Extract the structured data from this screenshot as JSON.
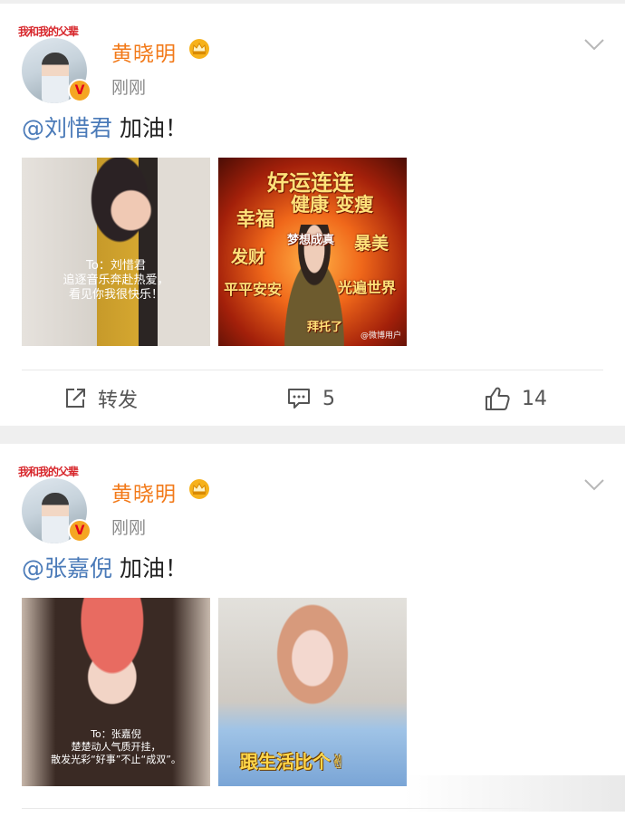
{
  "posts": [
    {
      "avatar_banner": "我和我的父辈",
      "username": "黄晓明",
      "timestamp": "刚刚",
      "mention": "@刘惜君",
      "text": " 加油！",
      "images": [
        {
          "dedication": [
            "To：刘惜君",
            "追逐音乐奔赴热爱，",
            "看见你我很快乐！"
          ]
        },
        {
          "words": [
            "好运连连",
            "幸福",
            "健康 变瘦",
            "梦想成真",
            "发财",
            "暴美",
            "平平安安",
            "光遍世界",
            "拜托了"
          ],
          "watermark": "@微博用户"
        }
      ],
      "actions": {
        "share": "转发",
        "comments": "5",
        "likes": "14"
      }
    },
    {
      "avatar_banner": "我和我的父辈",
      "username": "黄晓明",
      "timestamp": "刚刚",
      "mention": "@张嘉倪",
      "text": " 加油！",
      "images": [
        {
          "dedication": [
            "To：张嘉倪",
            "楚楚动人气质开挂，",
            "散发光彩“好事”不止“成双”。"
          ]
        },
        {
          "caption": "跟生活比个✌"
        }
      ]
    }
  ],
  "colors": {
    "username": "#f27a1a",
    "mention": "#4a7ab8",
    "timestamp": "#8a8a8a",
    "action": "#555555"
  }
}
